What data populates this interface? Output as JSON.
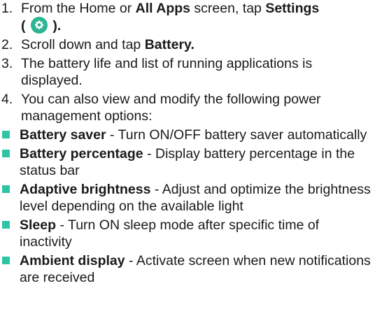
{
  "steps": [
    {
      "num": "1.",
      "pre": "From the Home or ",
      "bold1": "All Apps",
      "mid": " screen, tap ",
      "bold2": "Settings",
      "open": "(",
      "close": ").",
      "icon": "settings-gear-icon"
    },
    {
      "num": "2.",
      "pre": "Scroll down and tap ",
      "bold": "Battery."
    },
    {
      "num": "3.",
      "text": "The battery life and list of running applications is displayed."
    },
    {
      "num": "4.",
      "text": "You can also view and modify the following power management options:"
    }
  ],
  "options": [
    {
      "name": "Battery saver",
      "desc": " - Turn ON/OFF battery saver automatically"
    },
    {
      "name": "Battery percentage",
      "desc": " - Display battery percentage in the status bar"
    },
    {
      "name": "Adaptive brightness",
      "desc": " - Adjust and optimize the brightness level depending on the available light"
    },
    {
      "name": "Sleep",
      "desc": " - Turn ON sleep mode after specific time of inactivity"
    },
    {
      "name": "Ambient display",
      "desc": " - Activate screen when new notifications are received"
    }
  ],
  "colors": {
    "bullet": "#2ec4a6",
    "icon_bg": "#2bb592",
    "text": "#1a1a1a"
  }
}
